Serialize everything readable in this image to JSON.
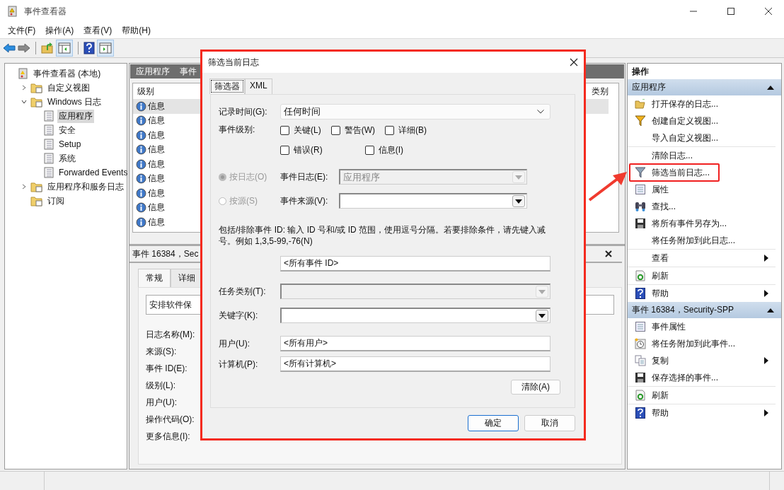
{
  "window": {
    "title": "事件查看器"
  },
  "menu": [
    "文件(F)",
    "操作(A)",
    "查看(V)",
    "帮助(H)"
  ],
  "tree": [
    {
      "label": "事件查看器 (本地)",
      "selected": false,
      "children": [
        {
          "label": "自定义视图",
          "selected": false,
          "expanded": false
        },
        {
          "label": "Windows 日志",
          "selected": false,
          "expanded": true,
          "children": [
            {
              "label": "应用程序",
              "selected": true
            },
            {
              "label": "安全",
              "selected": false
            },
            {
              "label": "Setup",
              "selected": false
            },
            {
              "label": "系统",
              "selected": false
            },
            {
              "label": "Forwarded Events",
              "selected": false
            }
          ]
        },
        {
          "label": "应用程序和服务日志",
          "selected": false,
          "expanded": false
        },
        {
          "label": "订阅",
          "selected": false
        }
      ]
    }
  ],
  "center": {
    "header": [
      "应用程序",
      "事件"
    ],
    "list": {
      "columns": [
        "级别",
        "类别"
      ],
      "rows": [
        {
          "severity": "信息",
          "selected": true
        },
        {
          "severity": "信息",
          "selected": false
        },
        {
          "severity": "信息",
          "selected": false
        },
        {
          "severity": "信息",
          "selected": false
        },
        {
          "severity": "信息",
          "selected": false
        },
        {
          "severity": "信息",
          "selected": false
        },
        {
          "severity": "信息",
          "selected": false
        },
        {
          "severity": "信息",
          "selected": false
        },
        {
          "severity": "信息",
          "selected": false
        }
      ]
    },
    "detail": {
      "title": "事件 16384，Sec",
      "tabs": [
        {
          "label": "常规",
          "selected": true
        },
        {
          "label": "详细",
          "selected": false
        }
      ],
      "description": "安排软件保",
      "fields": [
        "日志名称(M):",
        "来源(S):",
        "事件 ID(E):",
        "级别(L):",
        "用户(U):",
        "操作代码(O):",
        "更多信息(I):"
      ]
    }
  },
  "actions": {
    "title": "操作",
    "sections": [
      {
        "title": "应用程序",
        "expanded": true,
        "items": [
          {
            "label": "打开保存的日志...",
            "divider_above": false,
            "submenu": false,
            "annotated": false
          },
          {
            "label": "创建自定义视图...",
            "divider_above": false,
            "submenu": false,
            "annotated": false
          },
          {
            "label": "导入自定义视图...",
            "divider_above": false,
            "submenu": false,
            "annotated": false
          },
          {
            "label": "清除日志...",
            "divider_above": true,
            "submenu": false,
            "annotated": false
          },
          {
            "label": "筛选当前日志...",
            "divider_above": false,
            "submenu": false,
            "annotated": true
          },
          {
            "label": "属性",
            "divider_above": false,
            "submenu": false,
            "annotated": false
          },
          {
            "label": "查找...",
            "divider_above": false,
            "submenu": false,
            "annotated": false
          },
          {
            "label": "将所有事件另存为...",
            "divider_above": false,
            "submenu": false,
            "annotated": false
          },
          {
            "label": "将任务附加到此日志...",
            "divider_above": false,
            "submenu": false,
            "annotated": false
          },
          {
            "label": "查看",
            "divider_above": true,
            "submenu": true,
            "annotated": false
          },
          {
            "label": "刷新",
            "divider_above": true,
            "submenu": false,
            "annotated": false
          },
          {
            "label": "帮助",
            "divider_above": true,
            "submenu": true,
            "annotated": false
          }
        ]
      },
      {
        "title": "事件 16384，Security-SPP",
        "expanded": true,
        "items": [
          {
            "label": "事件属性",
            "divider_above": false,
            "submenu": false,
            "annotated": false
          },
          {
            "label": "将任务附加到此事件...",
            "divider_above": false,
            "submenu": false,
            "annotated": false
          },
          {
            "label": "复制",
            "divider_above": false,
            "submenu": true,
            "annotated": false
          },
          {
            "label": "保存选择的事件...",
            "divider_above": false,
            "submenu": false,
            "annotated": false
          },
          {
            "label": "刷新",
            "divider_above": true,
            "submenu": false,
            "annotated": false
          },
          {
            "label": "帮助",
            "divider_above": true,
            "submenu": true,
            "annotated": false
          }
        ]
      }
    ]
  },
  "dialog": {
    "title": "筛选当前日志",
    "tabs": [
      {
        "label": "筛选器",
        "selected": true
      },
      {
        "label": "XML",
        "selected": false
      }
    ],
    "logged": {
      "label": "记录时间(G):",
      "value": "任何时间"
    },
    "event_level": {
      "label": "事件级别:",
      "options": [
        {
          "label": "关键(L)",
          "checked": false
        },
        {
          "label": "警告(W)",
          "checked": false
        },
        {
          "label": "详细(B)",
          "checked": false
        },
        {
          "label": "错误(R)",
          "checked": false
        },
        {
          "label": "信息(I)",
          "checked": false
        }
      ]
    },
    "scope": [
      {
        "label": "按日志(O)",
        "selected": true,
        "disabled": true,
        "field_label": "事件日志(E):",
        "value": "应用程序",
        "field_disabled": true
      },
      {
        "label": "按源(S)",
        "selected": false,
        "disabled": true,
        "field_label": "事件来源(V):",
        "field_disabled": false
      }
    ],
    "hint": "包括/排除事件 ID: 输入 ID 号和/或 ID 范围，使用逗号分隔。若要排除条件，请先键入减号。例如 1,3,5-99,-76(N)",
    "event_ids": {
      "value": "<所有事件 ID>"
    },
    "task_category": {
      "label": "任务类别(T):",
      "disabled": true
    },
    "keywords": {
      "label": "关键字(K):",
      "disabled": false
    },
    "user": {
      "label": "用户(U):",
      "value": "<所有用户>"
    },
    "computer": {
      "label": "计算机(P):",
      "value": "<所有计算机>"
    },
    "clear_button": "清除(A)",
    "buttons": [
      {
        "label": "确定",
        "default": true
      },
      {
        "label": "取消",
        "default": false
      }
    ]
  }
}
